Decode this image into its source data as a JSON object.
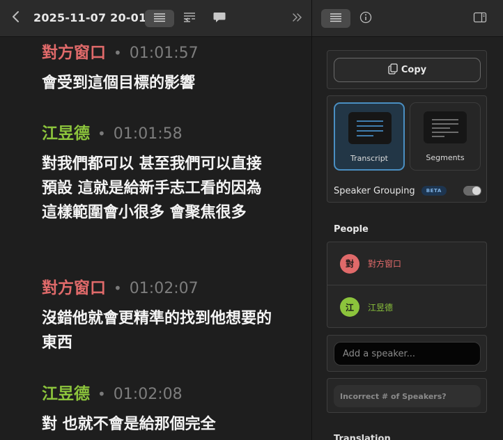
{
  "toolbar": {
    "title": "2025-11-07 20-01-...",
    "back_icon": "chevron-left-icon",
    "transcript_view_icon": "list-icon",
    "segments_view_icon": "segments-list-icon",
    "comment_icon": "speech-bubble-icon",
    "expand_icon": "double-chevron-right-icon"
  },
  "speakers": {
    "a": {
      "name": "對方窗口",
      "initial": "對",
      "color": "#e06a6a"
    },
    "b": {
      "name": "江昱德",
      "initial": "江",
      "color": "#8cc43c"
    }
  },
  "transcript": [
    {
      "speaker": "對方窗口",
      "time": "01:01:57",
      "text": "會受到這個目標的影響"
    },
    {
      "speaker": "江昱德",
      "time": "01:01:58",
      "text": "對我們都可以 甚至我們可以直接預設 這就是給新手志工看的因為這樣範圍會小很多 會聚焦很多"
    },
    {
      "speaker": "對方窗口",
      "time": "01:02:07",
      "text": "沒錯他就會更精準的找到他想要的東西"
    },
    {
      "speaker": "江昱德",
      "time": "01:02:08",
      "text": "對 也就不會是給那個完全"
    }
  ],
  "sidebar": {
    "toolbar": {
      "list_icon": "list-icon",
      "info_icon": "info-icon",
      "panel_icon": "sidebar-panel-icon"
    },
    "copy_label": "Copy",
    "views": [
      {
        "label": "Transcript",
        "selected": true
      },
      {
        "label": "Segments",
        "selected": false
      }
    ],
    "speaker_grouping": {
      "label": "Speaker Grouping",
      "badge": "BETA",
      "enabled": true
    },
    "people_heading": "People",
    "add_speaker_placeholder": "Add a speaker...",
    "incorrect_label": "Incorrect # of Speakers?",
    "next_section_label": "Translation"
  }
}
